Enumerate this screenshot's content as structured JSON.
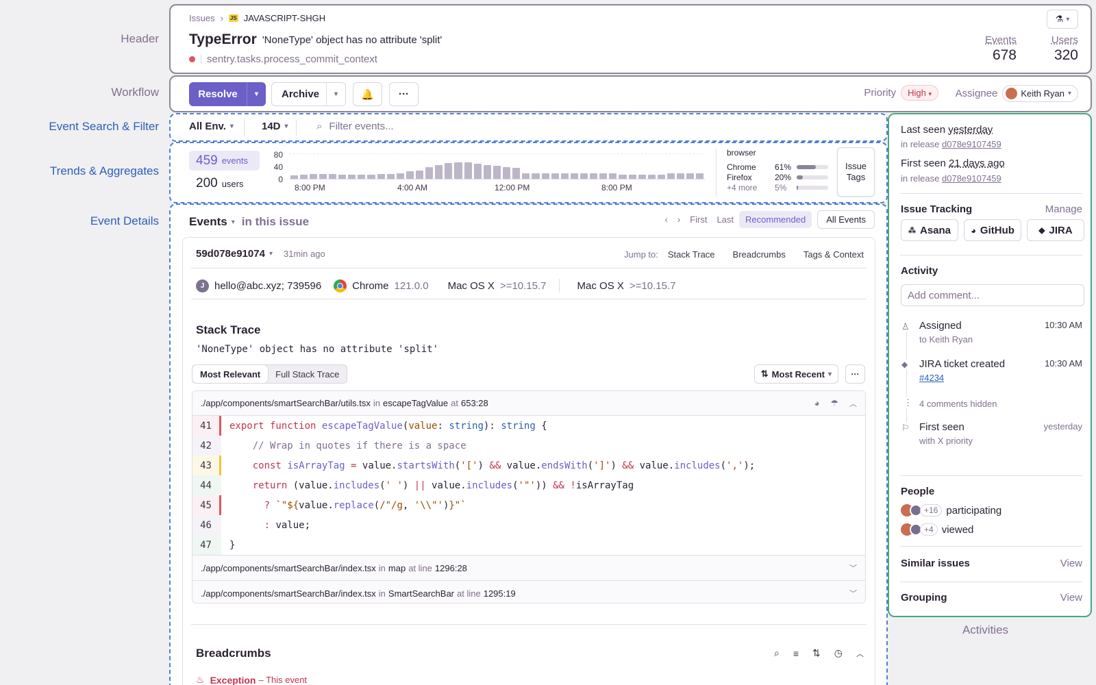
{
  "labels": {
    "header": "Header",
    "workflow": "Workflow",
    "search": "Event Search & Filter",
    "trends": "Trends & Aggregates",
    "details": "Event Details",
    "activities": "Activities"
  },
  "header": {
    "crumb_issues": "Issues",
    "crumb_project": "JAVASCRIPT-SHGH",
    "project_badge": "JS",
    "error_type": "TypeError",
    "error_msg": "'NoneType' object has no attribute 'split'",
    "culprit": "sentry.tasks.process_commit_context",
    "events_label": "Events",
    "events_value": "678",
    "users_label": "Users",
    "users_value": "320"
  },
  "workflow": {
    "resolve": "Resolve",
    "archive": "Archive",
    "priority_label": "Priority",
    "priority_value": "High",
    "assignee_label": "Assignee",
    "assignee_value": "Keith Ryan"
  },
  "filter": {
    "env": "All Env.",
    "period": "14D",
    "placeholder": "Filter events..."
  },
  "trends": {
    "events_count": "459",
    "events_word": "events",
    "users_count": "200",
    "users_word": "users",
    "y_ticks": [
      "80",
      "40",
      "0"
    ],
    "x_ticks": [
      "8:00 PM",
      "4:00 AM",
      "12:00 PM",
      "8:00 PM"
    ],
    "chart_data": {
      "type": "bar",
      "values": [
        10,
        12,
        14,
        14,
        14,
        13,
        13,
        13,
        13,
        15,
        15,
        17,
        23,
        26,
        35,
        43,
        48,
        50,
        50,
        47,
        42,
        39,
        35,
        33,
        17,
        17,
        17,
        17,
        17,
        17,
        17,
        17,
        17,
        17,
        12,
        12,
        12,
        12,
        12,
        17,
        17,
        17,
        17
      ],
      "ylim": [
        0,
        80
      ]
    },
    "browser_title": "browser",
    "browsers": [
      {
        "name": "Chrome",
        "pct": "61%",
        "frac": 0.61
      },
      {
        "name": "Firefox",
        "pct": "20%",
        "frac": 0.2
      },
      {
        "name": "+4 more",
        "pct": "5%",
        "frac": 0.05
      }
    ],
    "issue_tags_1": "Issue",
    "issue_tags_2": "Tags"
  },
  "events": {
    "title": "Events",
    "subtitle": "in this issue",
    "first": "First",
    "last": "Last",
    "recommended": "Recommended",
    "all_events": "All Events",
    "event_id": "59d078e91074",
    "age": "31min ago",
    "jump_to": "Jump to:",
    "jump_links": [
      "Stack Trace",
      "Breadcrumbs",
      "Tags & Context"
    ],
    "user_initial": "J",
    "user": "hello@abc.xyz; 739596",
    "browser_name": "Chrome",
    "browser_ver": "121.0.0",
    "os1_name": "Mac OS X",
    "os1_ver": ">=10.15.7",
    "os2_name": "Mac OS X",
    "os2_ver": ">=10.15.7"
  },
  "stack": {
    "title": "Stack Trace",
    "message": "'NoneType' object has no attribute 'split'",
    "tab_relevant": "Most Relevant",
    "tab_full": "Full Stack Trace",
    "sort": "Most Recent",
    "frame1": {
      "path": "./app/components/smartSearchBar/utils.tsx",
      "in": "in",
      "func": "escapeTagValue",
      "at": "at",
      "loc": "653:28"
    },
    "line_numbers": [
      "41",
      "42",
      "43",
      "44",
      "45",
      "46",
      "47"
    ],
    "frame2": {
      "path": "./app/components/smartSearchBar/index.tsx",
      "in": "in",
      "func": "map",
      "at": "at line",
      "loc": "1296:28"
    },
    "frame3": {
      "path": "./app/components/smartSearchBar/index.tsx",
      "in": "in",
      "func": "SmartSearchBar",
      "at": "at line",
      "loc": "1295:19"
    }
  },
  "breadcrumbs": {
    "title": "Breadcrumbs",
    "exception": "Exception",
    "this_event": "– This event"
  },
  "sidebar": {
    "last_seen_label": "Last seen",
    "last_seen_value": "yesterday",
    "release_label": "in release",
    "release_1": "d078e9107459",
    "first_seen_label": "First seen",
    "first_seen_value": "21 days ago",
    "release_2": "d078e9107459",
    "tracking_title": "Issue Tracking",
    "manage": "Manage",
    "trackers": [
      "Asana",
      "GitHub",
      "JIRA"
    ],
    "activity_title": "Activity",
    "comment_placeholder": "Add comment...",
    "act1_title": "Assigned",
    "act1_sub": "to Keith Ryan",
    "act1_time": "10:30 AM",
    "act2_title": "JIRA ticket created",
    "act2_sub": "#4234",
    "act2_time": "10:30 AM",
    "act3_title": "4 comments hidden",
    "act4_title": "First seen",
    "act4_sub": "with X priority",
    "act4_time": "yesterday",
    "people_title": "People",
    "participating_count": "+16",
    "participating": "participating",
    "viewed_count": "+4",
    "viewed": "viewed",
    "similar": "Similar issues",
    "similar_view": "View",
    "grouping": "Grouping",
    "grouping_view": "View"
  },
  "colors": {
    "accent": "#6c5fc7",
    "high": "#c2344d",
    "dash": "#4f7fd0",
    "green": "#4aa681"
  }
}
